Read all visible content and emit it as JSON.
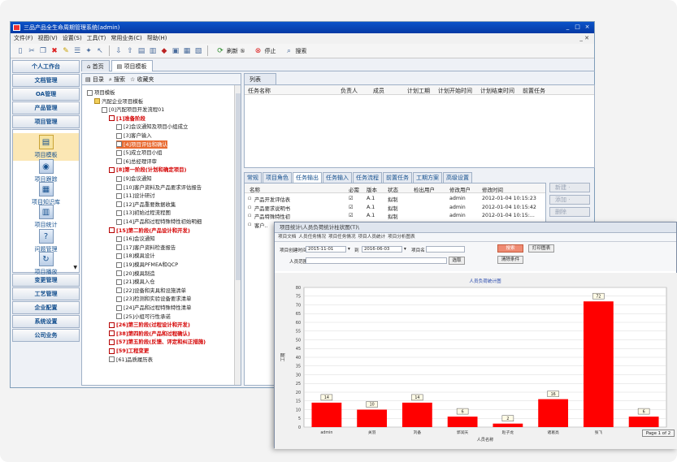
{
  "window": {
    "title": "三品产品全生命周期管理系统(admin)",
    "controls": [
      "_",
      "□",
      "×"
    ]
  },
  "menu": {
    "items": [
      "文件(F)",
      "视图(V)",
      "设置(S)",
      "工具(T)",
      "常用业务(C)",
      "帮助(H)"
    ],
    "right_controls": "_ ✕"
  },
  "toolbar": {
    "refresh_label": "刷新 ⑤",
    "stop_label": "停止",
    "search_label": "搜索"
  },
  "sidebar": {
    "top_modules": [
      "个人工作台",
      "文档管理",
      "OA管理",
      "产品管理",
      "项目管理"
    ],
    "icon_items": [
      {
        "label": "项目模板",
        "icon": "template-icon",
        "glyph": "▤"
      },
      {
        "label": "项目跟踪",
        "icon": "tracking-icon",
        "glyph": "◉"
      },
      {
        "label": "项目知识库",
        "icon": "knowledge-icon",
        "glyph": "▦"
      },
      {
        "label": "项目统计",
        "icon": "stats-icon",
        "glyph": "▥"
      },
      {
        "label": "问题管理",
        "icon": "question-icon",
        "glyph": "?"
      },
      {
        "label": "项目播放",
        "icon": "play-icon",
        "glyph": "↻"
      }
    ],
    "bottom_modules": [
      "变更管理",
      "工艺管理",
      "企业配置",
      "系统设置",
      "公司业务"
    ]
  },
  "doc_tabs": [
    "首页",
    "项目模板"
  ],
  "tree_tabs": [
    "目录",
    "搜索",
    "收藏夹"
  ],
  "tree": {
    "nodes": [
      {
        "text": "项目模板",
        "kind": "doc",
        "level": 0
      },
      {
        "text": "汽配企业项目模板",
        "kind": "folder",
        "level": 1
      },
      {
        "text": "[0]汽配项目开发流程01",
        "kind": "doc",
        "level": 2
      },
      {
        "text": "[1]准备阶段",
        "kind": "redflag",
        "level": 3,
        "style": "red"
      },
      {
        "text": "[2]会议通知及项目小组成立",
        "kind": "doc",
        "level": 4
      },
      {
        "text": "[3]客户输入",
        "kind": "doc",
        "level": 4
      },
      {
        "text": "[4]项目评估和确认",
        "kind": "doc",
        "level": 4,
        "style": "hl"
      },
      {
        "text": "[5]成立项目小组",
        "kind": "doc",
        "level": 4
      },
      {
        "text": "[6]总经理评审",
        "kind": "doc",
        "level": 4
      },
      {
        "text": "[8]第一阶段(计划和确定项目)",
        "kind": "redflag",
        "level": 3,
        "style": "red"
      },
      {
        "text": "[9]会议通知",
        "kind": "doc",
        "level": 4
      },
      {
        "text": "[10]客户资料及产品要求评估报告",
        "kind": "doc",
        "level": 4
      },
      {
        "text": "[11]设计研讨",
        "kind": "doc",
        "level": 4
      },
      {
        "text": "[12]产品重要数据收集",
        "kind": "doc",
        "level": 4
      },
      {
        "text": "[13]初始过程流程图",
        "kind": "doc",
        "level": 4
      },
      {
        "text": "[14]产品和过程特殊特性初始明细",
        "kind": "doc",
        "level": 4
      },
      {
        "text": "[15]第二阶段(产品设计和开发)",
        "kind": "redflag",
        "level": 3,
        "style": "red"
      },
      {
        "text": "[16]会议通知",
        "kind": "doc",
        "level": 4
      },
      {
        "text": "[17]客户资料检查报告",
        "kind": "doc",
        "level": 4
      },
      {
        "text": "[18]模具设计",
        "kind": "doc",
        "level": 4
      },
      {
        "text": "[19]模具PFMEA和QCP",
        "kind": "doc",
        "level": 4
      },
      {
        "text": "[20]模具制造",
        "kind": "doc",
        "level": 4
      },
      {
        "text": "[21]模具入仓",
        "kind": "doc",
        "level": 4
      },
      {
        "text": "[22]设备和夹具和设施清单",
        "kind": "doc",
        "level": 4
      },
      {
        "text": "[23]检测和实验设备要求清单",
        "kind": "doc",
        "level": 4
      },
      {
        "text": "[24]产品和过程特殊特性清单",
        "kind": "doc",
        "level": 4
      },
      {
        "text": "[25]小组可行性承诺",
        "kind": "doc",
        "level": 4
      },
      {
        "text": "[26]第三阶段(过程设计和开发)",
        "kind": "redflag",
        "level": 3,
        "style": "red"
      },
      {
        "text": "[38]第四阶段(产品和过程确认)",
        "kind": "redflag",
        "level": 3,
        "style": "red"
      },
      {
        "text": "[57]第五阶段(反馈、评定和纠正措施)",
        "kind": "redflag",
        "level": 3,
        "style": "red"
      },
      {
        "text": "[59]工程变更",
        "kind": "redflag",
        "level": 3,
        "style": "red"
      },
      {
        "text": "[61]品质履历表",
        "kind": "doc",
        "level": 3
      }
    ]
  },
  "task_list": {
    "tab": "列表",
    "columns": [
      "任务名称",
      "负责人",
      "成员",
      "计划工期",
      "计划开始时间",
      "计划结束时间",
      "前置任务"
    ]
  },
  "sub_tabs": [
    "常规",
    "项目角色",
    "任务输出",
    "任务输入",
    "任务流程",
    "前置任务",
    "工期方案",
    "高级设置"
  ],
  "files": {
    "columns": [
      "名称",
      "必需",
      "版本",
      "状态",
      "检出用户",
      "修改用户",
      "修改时间"
    ],
    "rows": [
      {
        "name": "产品开发评估表",
        "required": "☑",
        "version": "A.1",
        "status": "拟制",
        "checkout": "",
        "modifier": "admin",
        "time": "2012-01-04 10:15:23"
      },
      {
        "name": "产品要求说明书",
        "required": "☑",
        "version": "A.1",
        "status": "拟制",
        "checkout": "",
        "modifier": "admin",
        "time": "2012-01-04 10:15:42"
      },
      {
        "name": "产品特殊特性初",
        "required": "☑",
        "version": "A.1",
        "status": "拟制",
        "checkout": "",
        "modifier": "admin",
        "time": "2012-01-04 10:15:..."
      },
      {
        "name": "客户..",
        "required": "",
        "version": "",
        "status": "",
        "checkout": "",
        "modifier": "",
        "time": ""
      }
    ],
    "side_buttons": [
      "新建 ·",
      "添加 ·",
      "删除"
    ]
  },
  "overlay": {
    "title": "项目统计\\人员负荷统计柱状图(T)\\",
    "tabs": [
      "项目文档",
      "人员任务情况",
      "项目任务情况",
      "项目人员统计",
      "项目分析图表"
    ],
    "filter": {
      "start_label": "项目创建时间",
      "start_value": "2015-11-01",
      "to_label": "到",
      "end_value": "2016-06-03",
      "project_label": "项目名",
      "project_value": "",
      "person_label": "人员范围",
      "person_value": "",
      "pick_button": "选取",
      "search_button": "搜索",
      "print_button": "打印图表",
      "clear_button": "清除条件"
    },
    "pager": "Page 1 of 2"
  },
  "chart_data": {
    "type": "bar",
    "title": "人员负荷统计图",
    "xlabel": "人员名称",
    "ylabel": "工期",
    "categories": [
      "admin",
      "关羽",
      "刘备",
      "郭润天",
      "赵子龙",
      "诸葛亮",
      "张飞",
      ""
    ],
    "values": [
      14,
      10,
      14,
      6,
      2,
      16,
      72,
      6
    ],
    "ylim": [
      0,
      80
    ],
    "yticks": [
      0,
      5,
      10,
      15,
      20,
      25,
      30,
      35,
      40,
      45,
      50,
      55,
      60,
      65,
      70,
      75,
      80
    ],
    "bar_color": "#ff0000",
    "grid": true
  }
}
